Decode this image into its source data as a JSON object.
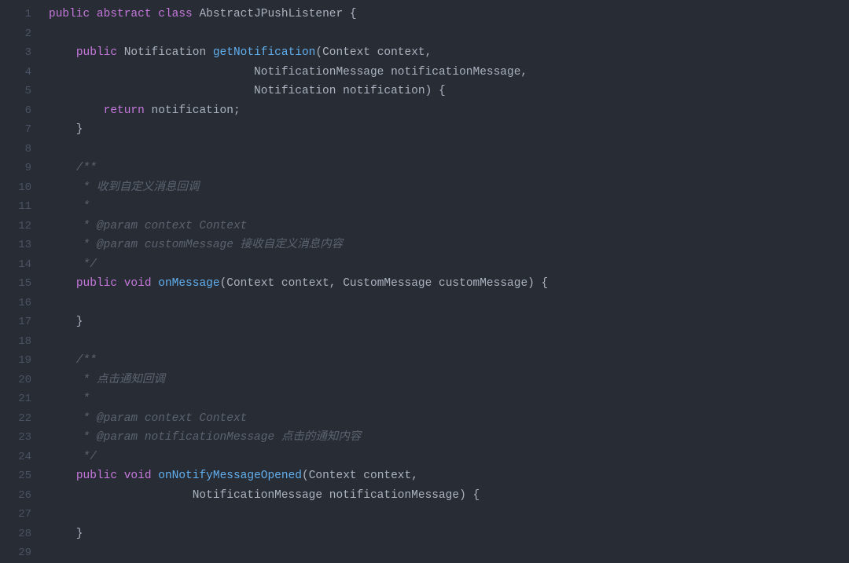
{
  "lines": [
    {
      "num": "1",
      "tokens": [
        {
          "t": "public",
          "c": "kw"
        },
        {
          "t": " ",
          "c": ""
        },
        {
          "t": "abstract",
          "c": "kw"
        },
        {
          "t": " ",
          "c": ""
        },
        {
          "t": "class",
          "c": "kw"
        },
        {
          "t": " ",
          "c": ""
        },
        {
          "t": "AbstractJPushListener",
          "c": "type"
        },
        {
          "t": " {",
          "c": "punct"
        }
      ]
    },
    {
      "num": "2",
      "tokens": []
    },
    {
      "num": "3",
      "tokens": [
        {
          "t": "    ",
          "c": ""
        },
        {
          "t": "public",
          "c": "kw"
        },
        {
          "t": " ",
          "c": ""
        },
        {
          "t": "Notification",
          "c": "type"
        },
        {
          "t": " ",
          "c": ""
        },
        {
          "t": "getNotification",
          "c": "fn"
        },
        {
          "t": "(",
          "c": "punct"
        },
        {
          "t": "Context context,",
          "c": "param"
        }
      ]
    },
    {
      "num": "4",
      "tokens": [
        {
          "t": "                              NotificationMessage notificationMessage,",
          "c": "param"
        }
      ]
    },
    {
      "num": "5",
      "tokens": [
        {
          "t": "                              Notification notification) {",
          "c": "param"
        }
      ]
    },
    {
      "num": "6",
      "tokens": [
        {
          "t": "        ",
          "c": ""
        },
        {
          "t": "return",
          "c": "kw"
        },
        {
          "t": " notification;",
          "c": "param"
        }
      ]
    },
    {
      "num": "7",
      "tokens": [
        {
          "t": "    }",
          "c": "punct"
        }
      ]
    },
    {
      "num": "8",
      "tokens": []
    },
    {
      "num": "9",
      "tokens": [
        {
          "t": "    /**",
          "c": "comment"
        }
      ]
    },
    {
      "num": "10",
      "tokens": [
        {
          "t": "     * 收到自定义消息回调",
          "c": "comment"
        }
      ]
    },
    {
      "num": "11",
      "tokens": [
        {
          "t": "     *",
          "c": "comment"
        }
      ]
    },
    {
      "num": "12",
      "tokens": [
        {
          "t": "     * @param context Context",
          "c": "comment"
        }
      ]
    },
    {
      "num": "13",
      "tokens": [
        {
          "t": "     * @param customMessage 接收自定义消息内容",
          "c": "comment"
        }
      ]
    },
    {
      "num": "14",
      "tokens": [
        {
          "t": "     */",
          "c": "comment"
        }
      ]
    },
    {
      "num": "15",
      "tokens": [
        {
          "t": "    ",
          "c": ""
        },
        {
          "t": "public",
          "c": "kw"
        },
        {
          "t": " ",
          "c": ""
        },
        {
          "t": "void",
          "c": "kw"
        },
        {
          "t": " ",
          "c": ""
        },
        {
          "t": "onMessage",
          "c": "fn"
        },
        {
          "t": "(",
          "c": "punct"
        },
        {
          "t": "Context context, CustomMessage customMessage) {",
          "c": "param"
        }
      ]
    },
    {
      "num": "16",
      "tokens": []
    },
    {
      "num": "17",
      "tokens": [
        {
          "t": "    }",
          "c": "punct"
        }
      ]
    },
    {
      "num": "18",
      "tokens": []
    },
    {
      "num": "19",
      "tokens": [
        {
          "t": "    /**",
          "c": "comment"
        }
      ]
    },
    {
      "num": "20",
      "tokens": [
        {
          "t": "     * 点击通知回调",
          "c": "comment"
        }
      ]
    },
    {
      "num": "21",
      "tokens": [
        {
          "t": "     *",
          "c": "comment"
        }
      ]
    },
    {
      "num": "22",
      "tokens": [
        {
          "t": "     * @param context Context",
          "c": "comment"
        }
      ]
    },
    {
      "num": "23",
      "tokens": [
        {
          "t": "     * @param notificationMessage 点击的通知内容",
          "c": "comment"
        }
      ]
    },
    {
      "num": "24",
      "tokens": [
        {
          "t": "     */",
          "c": "comment"
        }
      ]
    },
    {
      "num": "25",
      "tokens": [
        {
          "t": "    ",
          "c": ""
        },
        {
          "t": "public",
          "c": "kw"
        },
        {
          "t": " ",
          "c": ""
        },
        {
          "t": "void",
          "c": "kw"
        },
        {
          "t": " ",
          "c": ""
        },
        {
          "t": "onNotifyMessageOpened",
          "c": "fn"
        },
        {
          "t": "(",
          "c": "punct"
        },
        {
          "t": "Context context,",
          "c": "param"
        }
      ]
    },
    {
      "num": "26",
      "tokens": [
        {
          "t": "                     NotificationMessage notificationMessage) {",
          "c": "param"
        }
      ]
    },
    {
      "num": "27",
      "tokens": []
    },
    {
      "num": "28",
      "tokens": [
        {
          "t": "    }",
          "c": "punct"
        }
      ]
    },
    {
      "num": "29",
      "tokens": []
    }
  ]
}
